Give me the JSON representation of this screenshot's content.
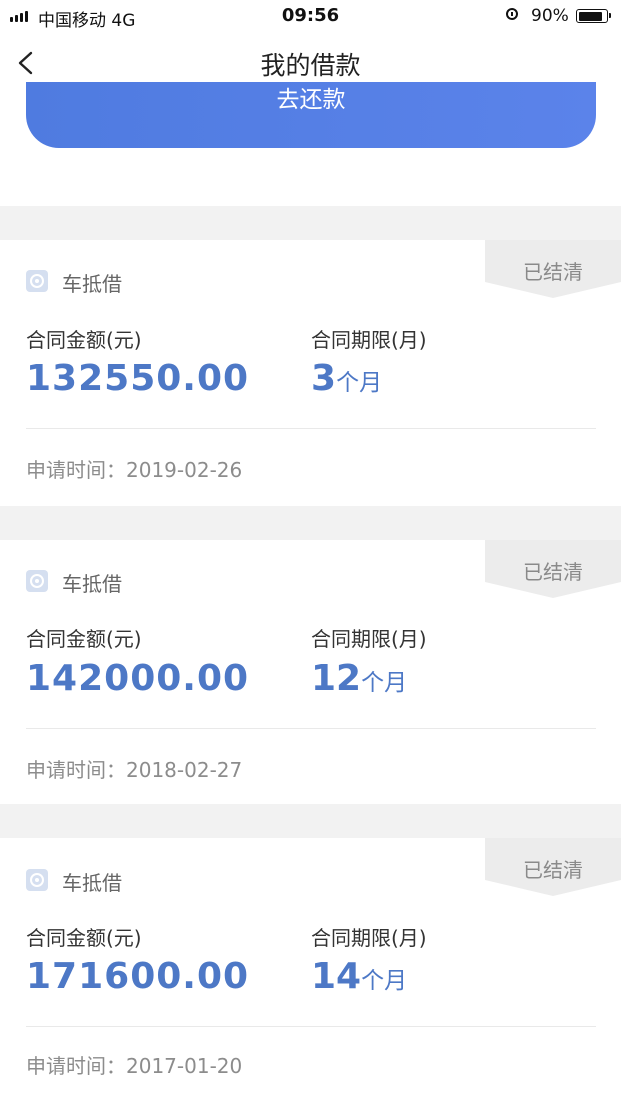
{
  "status_bar": {
    "carrier": "中国移动  4G",
    "time": "09:56",
    "battery": "90%",
    "battery_level": 0.9
  },
  "nav": {
    "title": "我的借款"
  },
  "repay_button": {
    "label": "去还款"
  },
  "loans": [
    {
      "status": "已结清",
      "product": "车抵借",
      "amount_label": "合同金额(元)",
      "amount": "132550.00",
      "term_label": "合同期限(月)",
      "term_value": "3",
      "term_unit": "个月",
      "apply_label": "申请时间：",
      "apply_date": "2019-02-26"
    },
    {
      "status": "已结清",
      "product": "车抵借",
      "amount_label": "合同金额(元)",
      "amount": "142000.00",
      "term_label": "合同期限(月)",
      "term_value": "12",
      "term_unit": "个月",
      "apply_label": "申请时间：",
      "apply_date": "2018-02-27"
    },
    {
      "status": "已结清",
      "product": "车抵借",
      "amount_label": "合同金额(元)",
      "amount": "171600.00",
      "term_label": "合同期限(月)",
      "term_value": "14",
      "term_unit": "个月",
      "apply_label": "申请时间：",
      "apply_date": "2017-01-20"
    }
  ]
}
